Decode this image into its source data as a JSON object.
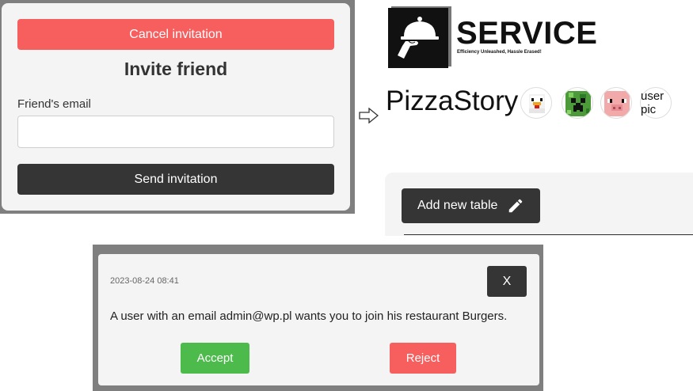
{
  "invite_dialog": {
    "cancel_label": "Cancel invitation",
    "title": "Invite friend",
    "email_label": "Friend's email",
    "email_value": "",
    "send_label": "Send invitation"
  },
  "logo": {
    "wordmark": "SERVICE",
    "tagline": "Efficiency Unleashed, Hassle Erased!",
    "icon": "waiter-cloche-icon"
  },
  "restaurant": {
    "name": "PizzaStory",
    "avatars": [
      {
        "icon": "chicken-avatar-icon"
      },
      {
        "icon": "creeper-avatar-icon"
      },
      {
        "icon": "pig-avatar-icon"
      }
    ],
    "userpic_line1": "user",
    "userpic_line2": "pic"
  },
  "tables": {
    "add_label": "Add new table",
    "add_icon": "pencil-icon"
  },
  "notification": {
    "date": "2023-08-24 08:41",
    "close_label": "X",
    "message": "A user with an email admin@wp.pl wants you to join his restaurant Burgers.",
    "accept_label": "Accept",
    "reject_label": "Reject"
  },
  "colors": {
    "danger": "#f75e5e",
    "success": "#4cbb4c",
    "dark": "#353535",
    "panel": "#f4f4f4",
    "frame": "#7f7f7f"
  }
}
